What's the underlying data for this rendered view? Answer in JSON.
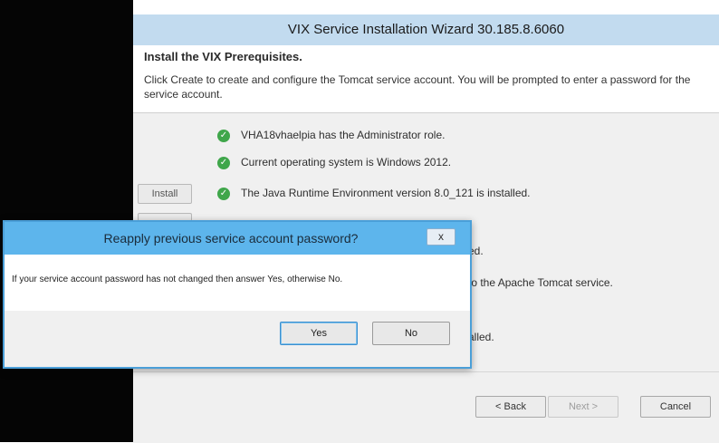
{
  "wizard": {
    "title": "VIX Service Installation Wizard 30.185.8.6060",
    "step_title": "Install the VIX Prerequisites.",
    "step_description": "Click Create to create and configure the Tomcat service account. You will be prompted to enter a password for the service account.",
    "install_button_label": "Install",
    "requirements": [
      "VHA18vhaelpia has the Administrator role.",
      "Current operating system is Windows 2012.",
      "The Java Runtime Environment version 8.0_121 is installed."
    ],
    "partial_texts": [
      "ed.",
      "to the Apache Tomcat service.",
      "alled."
    ],
    "footer": {
      "back_label": "< Back",
      "next_label": "Next >",
      "cancel_label": "Cancel"
    }
  },
  "dialog": {
    "title": "Reapply previous service account password?",
    "close_label": "x",
    "message": "If your service account password has not changed then answer Yes, otherwise No.",
    "yes_label": "Yes",
    "no_label": "No"
  },
  "colors": {
    "wizard_titlebar": "#c2dbef",
    "dialog_titlebar": "#5db5ec",
    "dialog_border": "#4a9fd8",
    "check_green": "#3fa64a"
  },
  "icons": {
    "check": "check-circle-icon",
    "close": "close-icon"
  }
}
